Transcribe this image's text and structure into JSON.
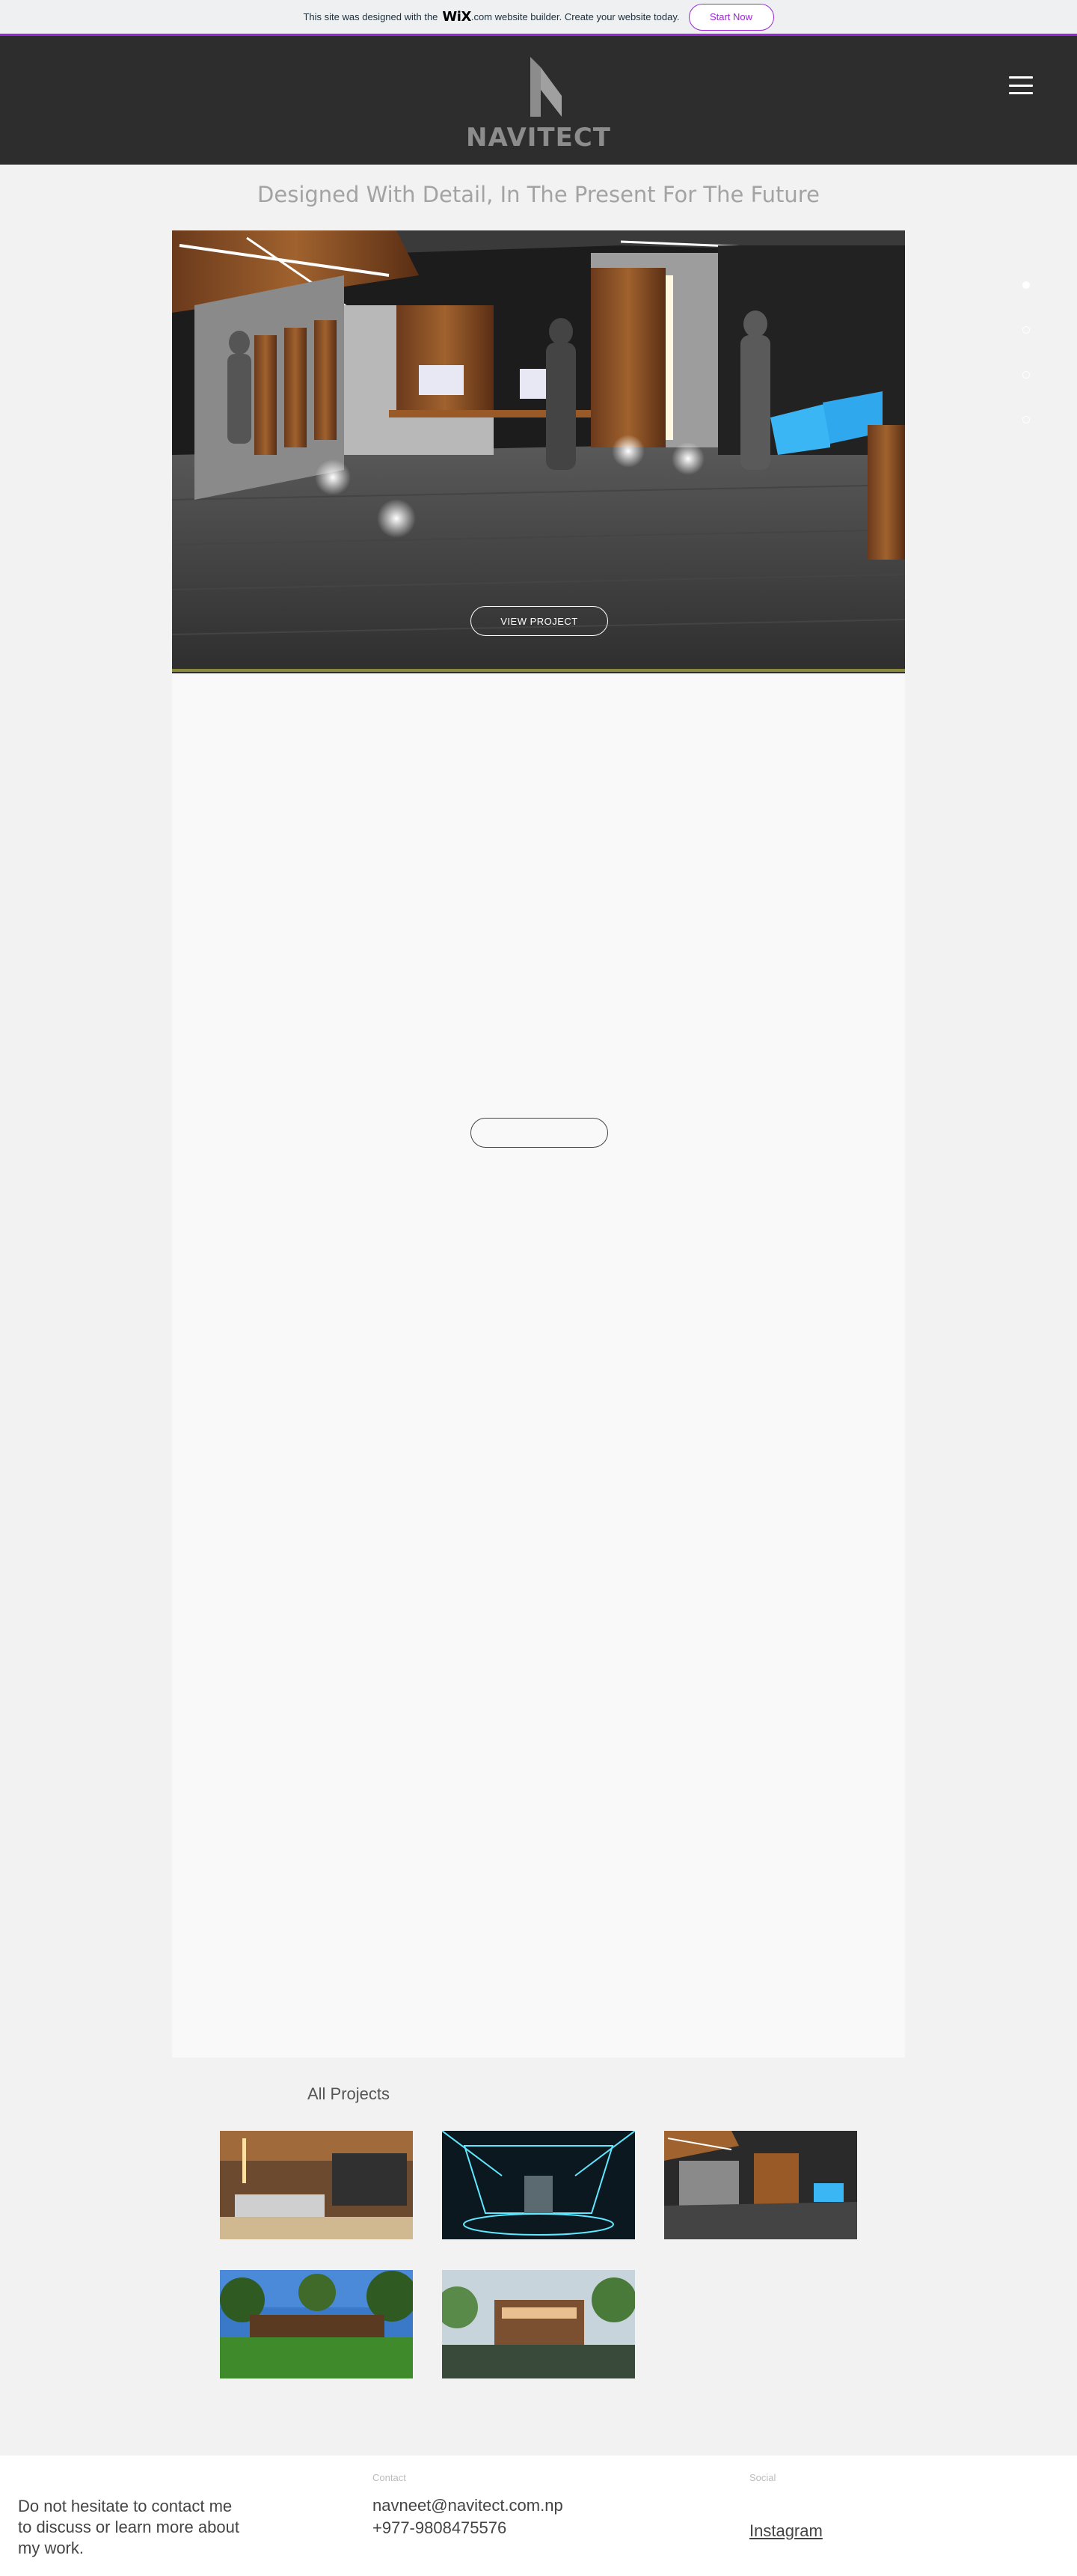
{
  "banner": {
    "text_before": "This site was designed with the",
    "wix_logo": "WiX",
    "text_after": ".com website builder. Create your website today.",
    "start_label": "Start Now",
    "accent": "#9a27d5"
  },
  "header": {
    "logo_text": "NAVITECT",
    "menu_icon": "hamburger-menu-icon",
    "bg": "#2d2d2d"
  },
  "tagline": "Designed With Detail, In The Present For The Future",
  "slideshow": {
    "view_label": "VIEW PROJECT",
    "dots": [
      {
        "active": true
      },
      {
        "active": false
      },
      {
        "active": false
      },
      {
        "active": false
      }
    ]
  },
  "projects": {
    "title": "All Projects",
    "thumbs": [
      "bedroom-interior",
      "futuristic-hall",
      "office-interior",
      "garden-pavilion",
      "resort-building"
    ]
  },
  "footer": {
    "message": "Do not hesitate to contact me to discuss or learn more about my work.",
    "contact_label": "Contact",
    "email": "navneet@navitect.com.np",
    "phone": "+977-9808475576",
    "social_label": "Social",
    "instagram": "Instagram"
  }
}
